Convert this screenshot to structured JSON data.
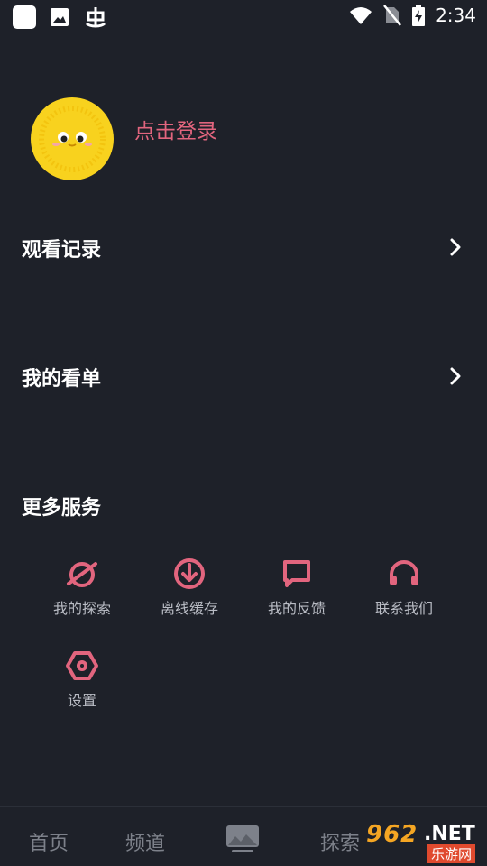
{
  "status_bar": {
    "time": "2:34",
    "left_icons": [
      "app-square-icon",
      "image-icon",
      "bug-icon"
    ],
    "right_icons": [
      "wifi-icon",
      "no-sim-icon",
      "battery-charging-icon"
    ]
  },
  "profile": {
    "login_label": "点击登录",
    "avatar_icon": "sun-face-avatar"
  },
  "menu": {
    "watch_history": "观看记录",
    "my_list": "我的看单"
  },
  "services": {
    "title": "更多服务",
    "items": [
      {
        "label": "我的探索",
        "icon": "explore-icon"
      },
      {
        "label": "离线缓存",
        "icon": "download-icon"
      },
      {
        "label": "我的反馈",
        "icon": "feedback-icon"
      },
      {
        "label": "联系我们",
        "icon": "headphones-icon"
      },
      {
        "label": "设置",
        "icon": "settings-hexagon-icon"
      }
    ]
  },
  "bottom_nav": {
    "home": "首页",
    "channels": "频道",
    "center_icon": "screen-icon",
    "explore": "探索"
  },
  "watermark": {
    "number": "962",
    "net": ".NET",
    "sub": "乐游网"
  },
  "colors": {
    "background": "#1e2129",
    "accent": "#e2657e",
    "avatar_yellow": "#f8d21e",
    "muted_text": "#b9bcc4",
    "nav_text": "#7d818a"
  }
}
